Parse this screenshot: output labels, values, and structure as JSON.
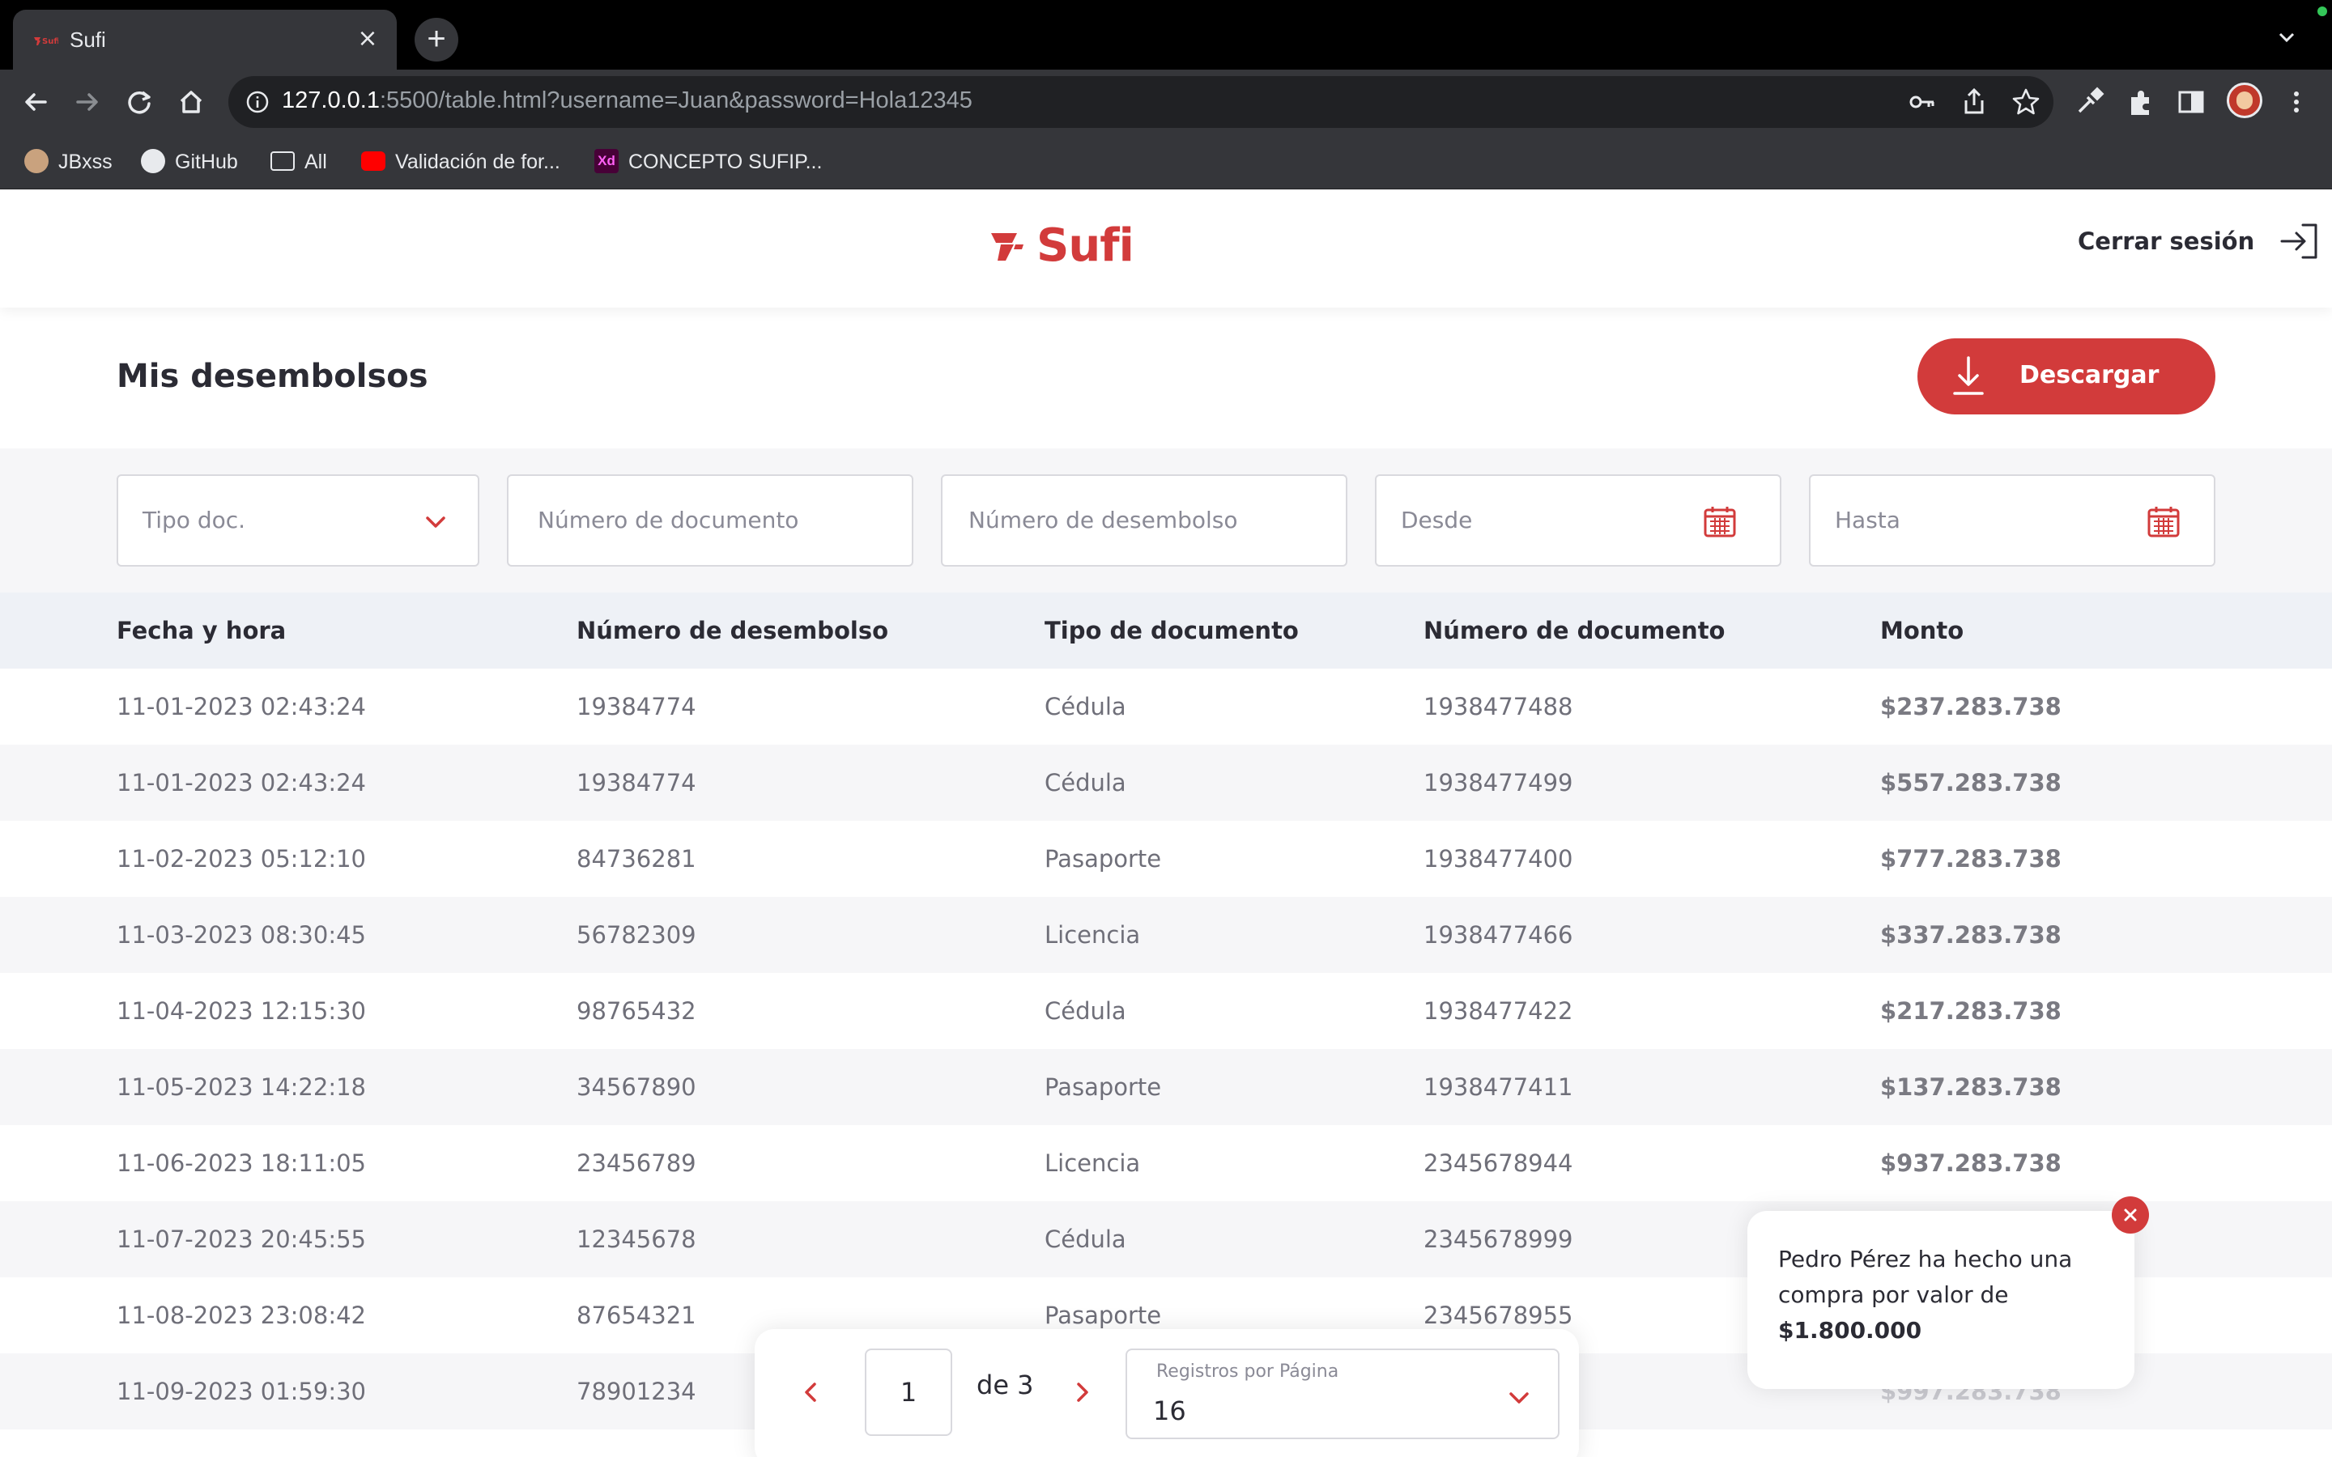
{
  "browser": {
    "tab_title": "Sufi",
    "tab_close": "×",
    "new_tab": "+",
    "url_host": "127.0.0.1",
    "url_rest": ":5500/table.html?username=Juan&password=Hola12345",
    "bookmarks": [
      {
        "label": "JBxss",
        "icon": "avatar-icon"
      },
      {
        "label": "GitHub",
        "icon": "github-icon"
      },
      {
        "label": "All",
        "icon": "folder-icon"
      },
      {
        "label": "Validación de for...",
        "icon": "youtube-icon"
      },
      {
        "label": "CONCEPTO SUFIP...",
        "icon": "xd-icon",
        "icon_text": "Xd"
      }
    ]
  },
  "header": {
    "logo": "Sufi",
    "logout_label": "Cerrar sesión"
  },
  "page": {
    "title": "Mis desembolsos",
    "download_label": "Descargar"
  },
  "filters": {
    "doc_type_placeholder": "Tipo doc.",
    "doc_number_placeholder": "Número de documento",
    "disbursement_number_placeholder": "Número de desembolso",
    "from_placeholder": "Desde",
    "to_placeholder": "Hasta"
  },
  "table": {
    "headers": [
      "Fecha y hora",
      "Número de desembolso",
      "Tipo de documento",
      "Número de documento",
      "Monto"
    ],
    "rows": [
      [
        "11-01-2023 02:43:24",
        "19384774",
        "Cédula",
        "1938477488",
        "$237.283.738"
      ],
      [
        "11-01-2023 02:43:24",
        "19384774",
        "Cédula",
        "1938477499",
        "$557.283.738"
      ],
      [
        "11-02-2023 05:12:10",
        "84736281",
        "Pasaporte",
        "1938477400",
        "$777.283.738"
      ],
      [
        "11-03-2023 08:30:45",
        "56782309",
        "Licencia",
        "1938477466",
        "$337.283.738"
      ],
      [
        "11-04-2023 12:15:30",
        "98765432",
        "Cédula",
        "1938477422",
        "$217.283.738"
      ],
      [
        "11-05-2023 14:22:18",
        "34567890",
        "Pasaporte",
        "1938477411",
        "$137.283.738"
      ],
      [
        "11-06-2023 18:11:05",
        "23456789",
        "Licencia",
        "2345678944",
        "$937.283.738"
      ],
      [
        "11-07-2023 20:45:55",
        "12345678",
        "Cédula",
        "2345678999",
        ""
      ],
      [
        "11-08-2023 23:08:42",
        "87654321",
        "Pasaporte",
        "2345678955",
        ""
      ],
      [
        "11-09-2023 01:59:30",
        "78901234",
        "",
        "",
        "$997.283.738"
      ]
    ]
  },
  "pagination": {
    "current_page": "1",
    "of_label": "de 3",
    "per_page_label": "Registros por Página",
    "per_page_value": "16"
  },
  "toast": {
    "message": "Pedro Pérez ha hecho una compra por valor de",
    "amount": "$1.800.000"
  },
  "colors": {
    "brand": "#d23b3b",
    "text": "#2b2b34",
    "muted": "#6f6f79"
  }
}
